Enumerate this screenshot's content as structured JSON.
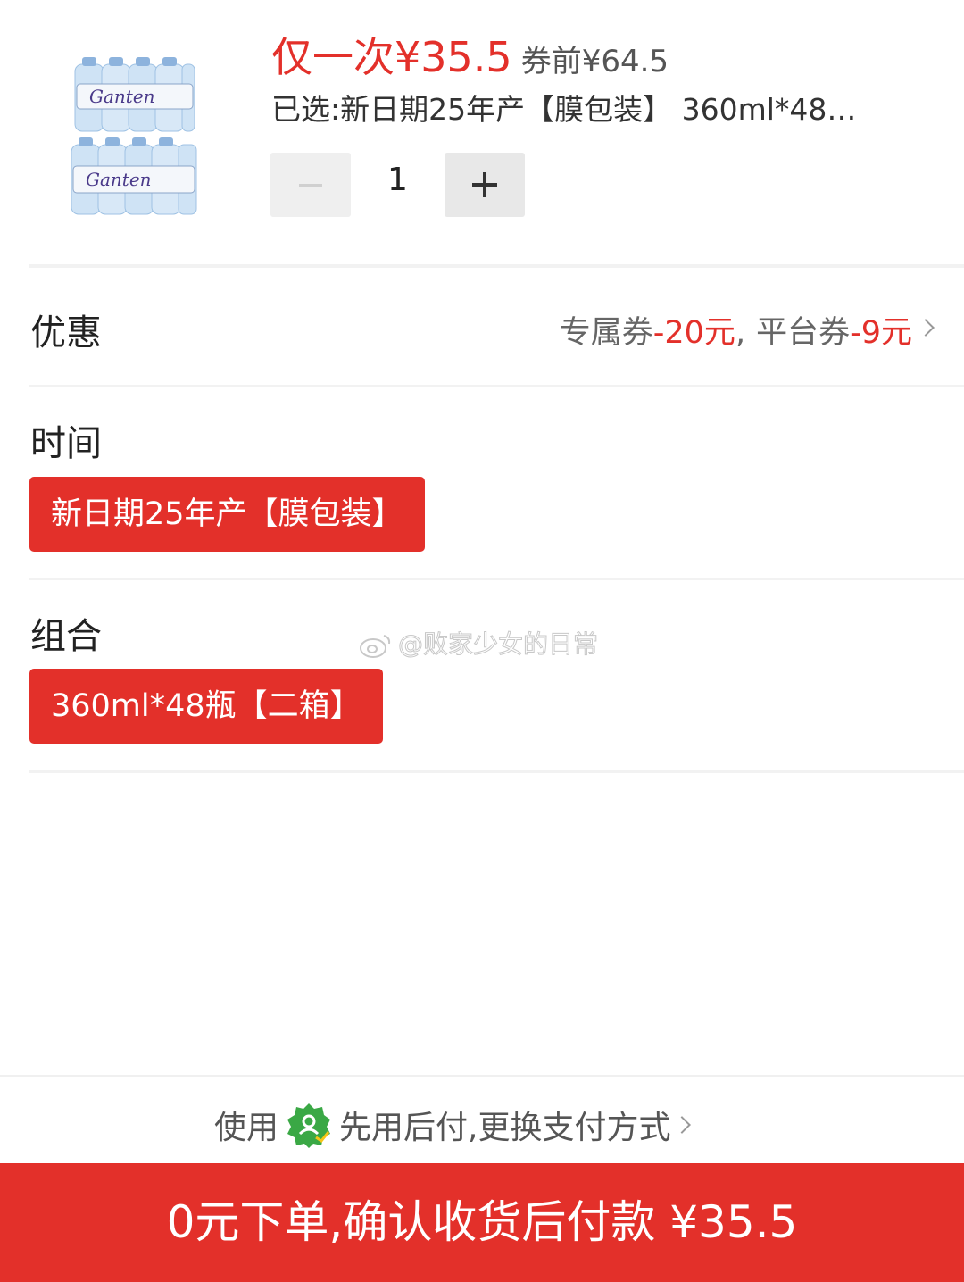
{
  "product": {
    "price_main": "仅一次¥35.5",
    "price_original": "券前¥64.5",
    "selected": "已选:新日期25年产【膜包装】 360ml*48…",
    "quantity": "1",
    "image_brand": "Ganten"
  },
  "discount": {
    "title": "优惠",
    "exclusive_label": "专属券",
    "exclusive_amount": "-20元",
    "separator": ",",
    "platform_label": "平台券",
    "platform_amount": "-9元"
  },
  "time": {
    "title": "时间",
    "option": "新日期25年产【膜包装】"
  },
  "combo": {
    "title": "组合",
    "option": "360ml*48瓶【二箱】"
  },
  "watermark": "@败家少女的日常",
  "payment": {
    "prefix": "使用",
    "method": "先用后付,更换支付方式"
  },
  "cta": {
    "label": "0元下单,确认收货后付款 ¥35.5"
  },
  "colors": {
    "accent": "#e3302a",
    "badge_green": "#3aa845"
  }
}
